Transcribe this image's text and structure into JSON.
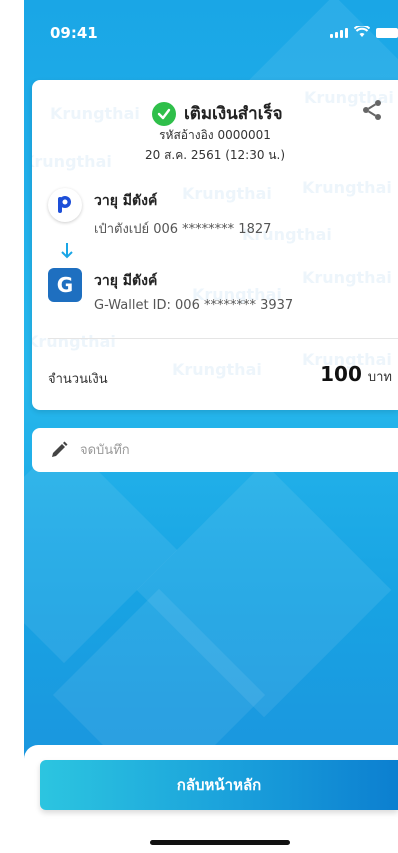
{
  "status_bar": {
    "time": "09:41"
  },
  "receipt": {
    "title": "เติมเงินสำเร็จ",
    "reference": "รหัสอ้างอิง 0000001",
    "datetime": "20 ส.ค. 2561 (12:30 น.)",
    "watermark": "Krungthai",
    "from": {
      "name": "วายุ มีตังค์",
      "account": "เป๋าตังเปย์ 006 ******** 1827",
      "logo": "paotang-logo"
    },
    "to": {
      "name": "วายุ มีตังค์",
      "account": "G-Wallet ID: 006 ******** 3937",
      "logo": "g-wallet-logo",
      "logo_letter": "G"
    },
    "amount_label": "จำนวนเงิน",
    "amount": "100",
    "currency": "บาท"
  },
  "note": {
    "placeholder": "จดบันทึก",
    "value": ""
  },
  "actions": {
    "home_label": "กลับหน้าหลัก"
  },
  "colors": {
    "accent": "#1aa6e6",
    "success": "#2fbf4a",
    "button_start": "#2cc5e0",
    "button_end": "#0c7fd0"
  }
}
